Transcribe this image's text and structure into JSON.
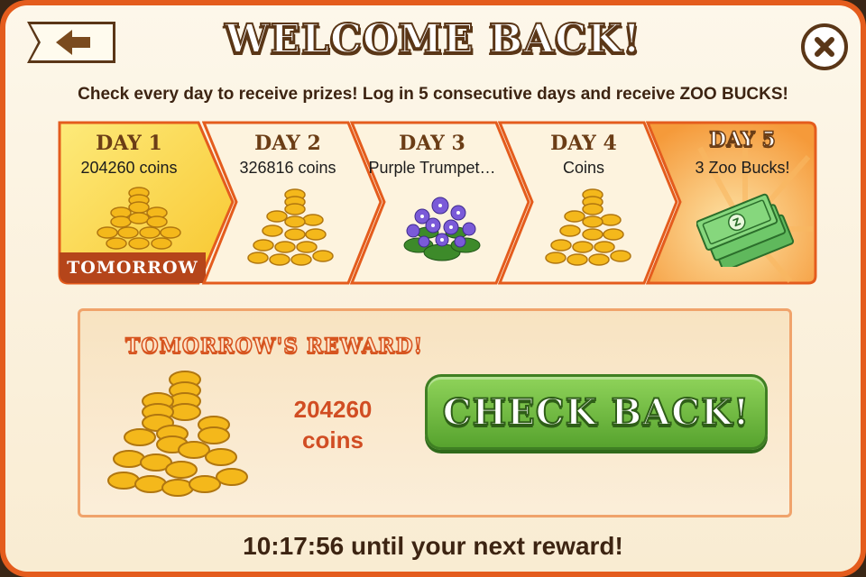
{
  "header": {
    "title": "WELCOME BACK!",
    "subtitle": "Check every day to receive prizes! Log in 5 consecutive days and receive ZOO BUCKS!"
  },
  "days": [
    {
      "name": "DAY 1",
      "reward": "204260 coins",
      "art": "coin-pile",
      "badge": "TOMORROW",
      "state": "next"
    },
    {
      "name": "DAY 2",
      "reward": "326816 coins",
      "art": "coin-pile"
    },
    {
      "name": "DAY 3",
      "reward": "Purple Trumpet…",
      "art": "purple-flower-bush"
    },
    {
      "name": "DAY 4",
      "reward": "Coins",
      "art": "coin-pile"
    },
    {
      "name": "DAY 5",
      "reward": "3 Zoo Bucks!",
      "art": "zoo-bucks-bills",
      "state": "bonus"
    }
  ],
  "reward_panel": {
    "title": "TOMORROW'S REWARD!",
    "amount_value": "204260",
    "amount_unit": "coins",
    "button_label": "CHECK BACK!"
  },
  "countdown": "10:17:56 until your next reward!",
  "colors": {
    "frame": "#e45c1d",
    "brown_text": "#3d2412",
    "accent_red": "#d14d23",
    "green_button": "#6cb83f",
    "day1_yellow": "#fbd339",
    "day5_orange": "#f7a13c"
  }
}
